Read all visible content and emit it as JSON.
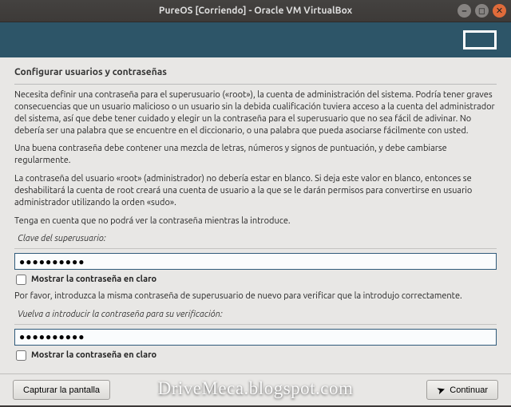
{
  "window": {
    "title": "PureOS [Corriendo] - Oracle VM VirtualBox"
  },
  "installer": {
    "section_title": "Configurar usuarios y contraseñas",
    "p1": "Necesita definir una contraseña para el superusuario («root»), la cuenta de administración del sistema. Podría tener graves consecuencias que un usuario malicioso o un usuario sin la debida cualificación tuviera acceso a la cuenta del administrador del sistema, así que debe tener cuidado y elegir un la contraseña para el superusuario que no sea fácil de adivinar. No debería ser una palabra que se encuentre en el diccionario, o una palabra que pueda asociarse fácilmente con usted.",
    "p2": "Una buena contraseña debe contener una mezcla de letras, números y signos de puntuación, y debe cambiarse regularmente.",
    "p3": "La contraseña del usuario «root» (administrador) no debería estar en blanco. Si deja este valor en blanco, entonces se deshabilitará la cuenta de root creará una cuenta de usuario a la que se le darán permisos para convertirse en usuario administrador utilizando la orden «sudo».",
    "p4": "Tenga en cuenta que no podrá ver la contraseña mientras la introduce.",
    "label1": "Clave del superusuario:",
    "show1": "Mostrar la contraseña en claro",
    "p5": "Por favor, introduzca la misma contraseña de superusuario de nuevo para verificar que la introdujo correctamente.",
    "label2": "Vuelva a introducir la contraseña para su verificación:",
    "show2": "Mostrar la contraseña en claro",
    "pw1_value": "●●●●●●●●●●",
    "pw2_value": "●●●●●●●●●●"
  },
  "buttons": {
    "screenshot": "Capturar la pantalla",
    "continue": "Continuar"
  },
  "watermark": "DriveMeca.blogspot.com"
}
